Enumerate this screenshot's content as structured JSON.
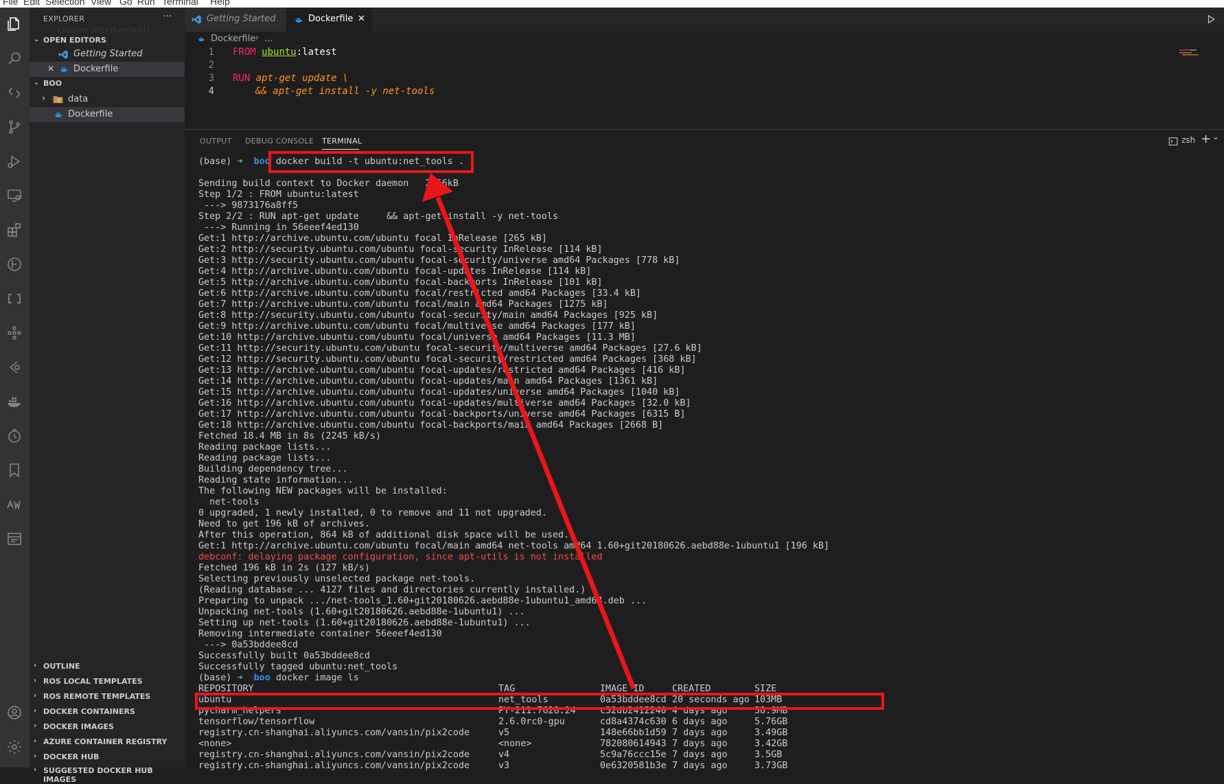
{
  "menu": [
    "File",
    "Edit",
    "Selection",
    "View",
    "Go",
    "Run",
    "Terminal",
    "Help"
  ],
  "sidebar": {
    "title": "EXPLORER",
    "more": "···",
    "tooltip": "Explorer (Alt+NumPad1)",
    "open_editors_header": "OPEN EDITORS",
    "open_editors": [
      "Getting Started",
      "Dockerfile"
    ],
    "close_glyph": "✕",
    "folder_header": "BOO",
    "tree": [
      {
        "label": "data",
        "kind": "folder"
      },
      {
        "label": "Dockerfile",
        "kind": "file"
      }
    ],
    "bottom_sections": [
      "OUTLINE",
      "ROS LOCAL TEMPLATES",
      "ROS REMOTE TEMPLATES",
      "DOCKER CONTAINERS",
      "DOCKER IMAGES",
      "AZURE CONTAINER REGISTRY",
      "DOCKER HUB",
      "SUGGESTED DOCKER HUB IMAGES"
    ]
  },
  "tabs": [
    {
      "label": "Getting Started",
      "active": false
    },
    {
      "label": "Dockerfile",
      "active": true,
      "close": "✕"
    }
  ],
  "breadcrumb": {
    "file": "Dockerfile",
    "sep": "›",
    "rest": "..."
  },
  "editor": {
    "line_numbers": [
      "1",
      "2",
      "3",
      "4"
    ],
    "line1": {
      "kw": "FROM",
      "image": "ubuntu",
      "tag": ":latest"
    },
    "line3": {
      "kw": "RUN",
      "cmd": "apt-get update \\"
    },
    "line4": {
      "cmd": "&& apt-get install -y net-tools"
    }
  },
  "panel": {
    "tabs": [
      "OUTPUT",
      "DEBUG CONSOLE",
      "TERMINAL"
    ],
    "shell": "zsh",
    "add": "+",
    "dropdown": "⌄"
  },
  "terminal": {
    "prompt": {
      "env": "(base)",
      "arrow": "➜",
      "dir": "boo"
    },
    "cmd1": "docker build -t ubuntu:net_tools .",
    "cmd2": "docker image ls",
    "output": [
      "Sending build context to Docker daemon   2.56kB",
      "Step 1/2 : FROM ubuntu:latest",
      " ---> 9873176a8ff5",
      "Step 2/2 : RUN apt-get update     && apt-get install -y net-tools",
      " ---> Running in 56eeef4ed130",
      "Get:1 http://archive.ubuntu.com/ubuntu focal InRelease [265 kB]",
      "Get:2 http://security.ubuntu.com/ubuntu focal-security InRelease [114 kB]",
      "Get:3 http://security.ubuntu.com/ubuntu focal-security/universe amd64 Packages [778 kB]",
      "Get:4 http://archive.ubuntu.com/ubuntu focal-updates InRelease [114 kB]",
      "Get:5 http://archive.ubuntu.com/ubuntu focal-backports InRelease [101 kB]",
      "Get:6 http://archive.ubuntu.com/ubuntu focal/restricted amd64 Packages [33.4 kB]",
      "Get:7 http://archive.ubuntu.com/ubuntu focal/main amd64 Packages [1275 kB]",
      "Get:8 http://security.ubuntu.com/ubuntu focal-security/main amd64 Packages [925 kB]",
      "Get:9 http://archive.ubuntu.com/ubuntu focal/multiverse amd64 Packages [177 kB]",
      "Get:10 http://archive.ubuntu.com/ubuntu focal/universe amd64 Packages [11.3 MB]",
      "Get:11 http://security.ubuntu.com/ubuntu focal-security/multiverse amd64 Packages [27.6 kB]",
      "Get:12 http://security.ubuntu.com/ubuntu focal-security/restricted amd64 Packages [368 kB]",
      "Get:13 http://archive.ubuntu.com/ubuntu focal-updates/restricted amd64 Packages [416 kB]",
      "Get:14 http://archive.ubuntu.com/ubuntu focal-updates/main amd64 Packages [1361 kB]",
      "Get:15 http://archive.ubuntu.com/ubuntu focal-updates/universe amd64 Packages [1040 kB]",
      "Get:16 http://archive.ubuntu.com/ubuntu focal-updates/multiverse amd64 Packages [32.0 kB]",
      "Get:17 http://archive.ubuntu.com/ubuntu focal-backports/universe amd64 Packages [6315 B]",
      "Get:18 http://archive.ubuntu.com/ubuntu focal-backports/main amd64 Packages [2668 B]",
      "Fetched 18.4 MB in 8s (2245 kB/s)",
      "Reading package lists...",
      "Reading package lists...",
      "Building dependency tree...",
      "Reading state information...",
      "The following NEW packages will be installed:",
      "  net-tools",
      "0 upgraded, 1 newly installed, 0 to remove and 11 not upgraded.",
      "Need to get 196 kB of archives.",
      "After this operation, 864 kB of additional disk space will be used.",
      "Get:1 http://archive.ubuntu.com/ubuntu focal/main amd64 net-tools amd64 1.60+git20180626.aebd88e-1ubuntu1 [196 kB]",
      "debconf: delaying package configuration, since apt-utils is not installed",
      "Fetched 196 kB in 2s (127 kB/s)",
      "Selecting previously unselected package net-tools.",
      "(Reading database ... 4127 files and directories currently installed.)",
      "Preparing to unpack .../net-tools_1.60+git20180626.aebd88e-1ubuntu1_amd64.deb ...",
      "Unpacking net-tools (1.60+git20180626.aebd88e-1ubuntu1) ...",
      "Setting up net-tools (1.60+git20180626.aebd88e-1ubuntu1) ...",
      "Removing intermediate container 56eeef4ed130",
      " ---> 0a53bddee8cd",
      "Successfully built 0a53bddee8cd",
      "Successfully tagged ubuntu:net_tools"
    ],
    "error_line_index": 34,
    "table_headers": [
      "REPOSITORY",
      "TAG",
      "IMAGE ID",
      "CREATED",
      "SIZE"
    ],
    "table_rows": [
      [
        "ubuntu",
        "net_tools",
        "0a53bddee8cd",
        "20 seconds ago",
        "103MB"
      ],
      [
        "pycharm_helpers",
        "PY-211.7628.24",
        "c32db2412240",
        "4 days ago",
        "38.9MB"
      ],
      [
        "tensorflow/tensorflow",
        "2.6.0rc0-gpu",
        "cd8a4374c630",
        "6 days ago",
        "5.76GB"
      ],
      [
        "registry.cn-shanghai.aliyuncs.com/vansin/pix2code",
        "v5",
        "148e66bb1d59",
        "7 days ago",
        "3.49GB"
      ],
      [
        "<none>",
        "<none>",
        "782080614943",
        "7 days ago",
        "3.42GB"
      ],
      [
        "registry.cn-shanghai.aliyuncs.com/vansin/pix2code",
        "v4",
        "5c9a76ccc15e",
        "7 days ago",
        "3.5GB"
      ],
      [
        "registry.cn-shanghai.aliyuncs.com/vansin/pix2code",
        "v3",
        "0e6320581b3e",
        "7 days ago",
        "3.73GB"
      ]
    ]
  },
  "colors": {
    "annotation": "#e8161b",
    "prompt_arrow": "#23d18b",
    "prompt_dir": "#3b8eea",
    "error_text": "#f14c4c"
  },
  "icons": [
    "files-icon",
    "search-icon",
    "remote-icon",
    "source-control-icon",
    "run-debug-icon",
    "remote-explorer-icon",
    "extensions-icon",
    "timeline-icon",
    "brackets-icon",
    "ros-icon",
    "git-graph-icon",
    "docker-icon",
    "history-icon",
    "bookmark-icon",
    "aw-icon",
    "panel-icon",
    "account-icon",
    "settings-gear-icon"
  ]
}
